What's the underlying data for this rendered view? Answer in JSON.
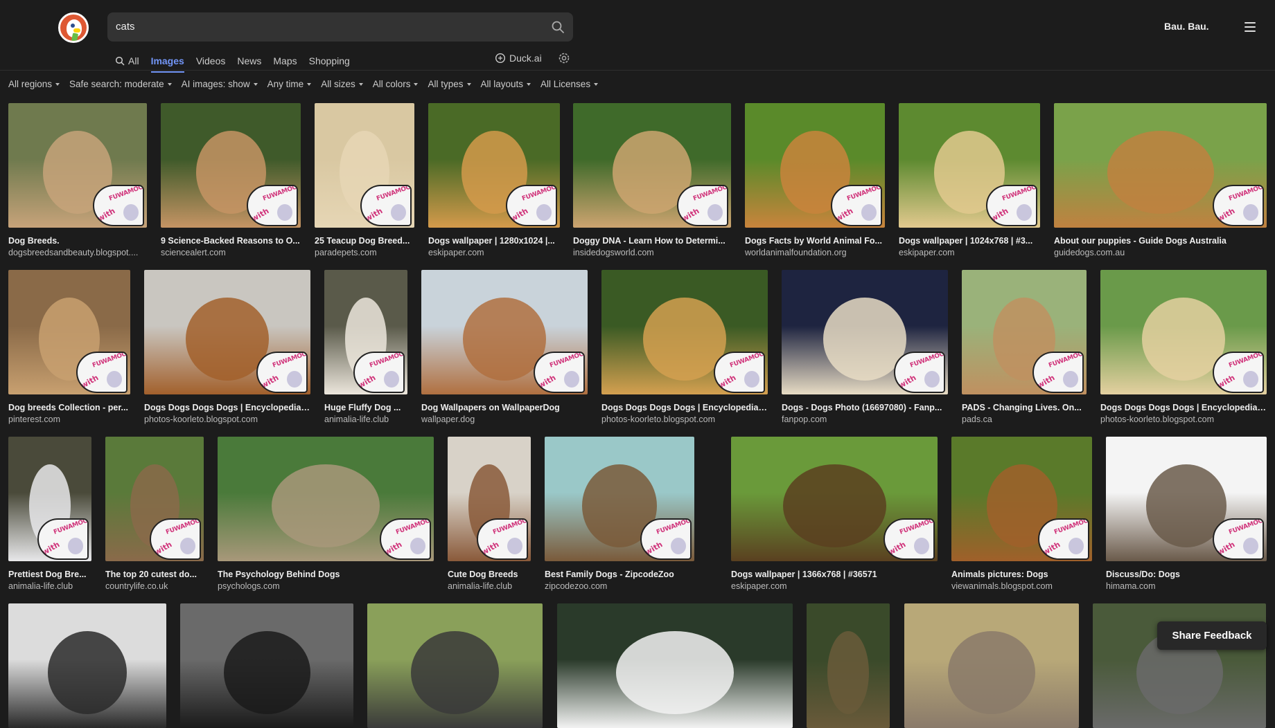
{
  "header": {
    "search_value": "cats",
    "user_label": "Bau. Bau.",
    "duckai_label": "Duck.ai",
    "tabs": [
      {
        "label": "All",
        "icon": "search-icon",
        "active": false
      },
      {
        "label": "Images",
        "active": true
      },
      {
        "label": "Videos",
        "active": false
      },
      {
        "label": "News",
        "active": false
      },
      {
        "label": "Maps",
        "active": false
      },
      {
        "label": "Shopping",
        "active": false
      }
    ]
  },
  "filters": [
    "All regions",
    "Safe search: moderate",
    "AI images: show",
    "Any time",
    "All sizes",
    "All colors",
    "All types",
    "All layouts",
    "All Licenses"
  ],
  "colors": {
    "accent": "#7295f6",
    "background": "#1c1c1c",
    "logo": "#de5833"
  },
  "rows": [
    [
      {
        "title": "Dog Breeds.",
        "domain": "dogsbreedsandbeauty.blogspot....",
        "colors": [
          "#6f7a4e",
          "#c7a37a"
        ]
      },
      {
        "title": "9 Science-Backed Reasons to O...",
        "domain": "sciencealert.com",
        "colors": [
          "#3f5a2a",
          "#c59464"
        ]
      },
      {
        "title": "25 Teacup Dog Breed...",
        "domain": "paradepets.com",
        "colors": [
          "#d9c8a2",
          "#e6d6b5"
        ]
      },
      {
        "title": "Dogs wallpaper | 1280x1024 |...",
        "domain": "eskipaper.com",
        "colors": [
          "#4a6a26",
          "#d49a4b"
        ]
      },
      {
        "title": "Doggy DNA - Learn How to Determi...",
        "domain": "insidedogsworld.com",
        "colors": [
          "#3f6a2a",
          "#cda470"
        ]
      },
      {
        "title": "Dogs Facts by World Animal Fo...",
        "domain": "worldanimalfoundation.org",
        "colors": [
          "#5a8a2a",
          "#c9843c"
        ]
      },
      {
        "title": "Dogs wallpaper | 1024x768 | #3...",
        "domain": "eskipaper.com",
        "colors": [
          "#5d8a30",
          "#e2c98e"
        ]
      },
      {
        "title": "About our puppies - Guide Dogs Australia",
        "domain": "guidedogs.com.au",
        "colors": [
          "#7aa24a",
          "#c08140"
        ]
      }
    ],
    [
      {
        "title": "Dog breeds Collection - per...",
        "domain": "pinterest.com",
        "colors": [
          "#8a6a48",
          "#c8a070"
        ]
      },
      {
        "title": "Dogs Dogs Dogs Dogs | Encyclopedia ...",
        "domain": "photos-koorleto.blogspot.com",
        "colors": [
          "#c9c6c0",
          "#a2602c"
        ]
      },
      {
        "title": "Huge Fluffy Dog ...",
        "domain": "animalia-life.club",
        "colors": [
          "#5a5a4a",
          "#ece6dc"
        ]
      },
      {
        "title": "Dog Wallpapers on WallpaperDog",
        "domain": "wallpaper.dog",
        "colors": [
          "#c9d3da",
          "#b07040"
        ]
      },
      {
        "title": "Dogs Dogs Dogs Dogs | Encyclopedia ...",
        "domain": "photos-koorleto.blogspot.com",
        "colors": [
          "#3a5a24",
          "#d4a050"
        ]
      },
      {
        "title": "Dogs - Dogs Photo (16697080) - Fanp...",
        "domain": "fanpop.com",
        "colors": [
          "#1e2440",
          "#e8dcc4"
        ]
      },
      {
        "title": "PADS - Changing Lives. On...",
        "domain": "pads.ca",
        "colors": [
          "#9ab27a",
          "#c09060"
        ]
      },
      {
        "title": "Dogs Dogs Dogs Dogs | Encyclopedia ...",
        "domain": "photos-koorleto.blogspot.com",
        "colors": [
          "#6a9a4a",
          "#e4d0a0"
        ]
      }
    ],
    [
      {
        "title": "Prettiest Dog Bre...",
        "domain": "animalia-life.club",
        "colors": [
          "#4a4a3a",
          "#e8e8ea"
        ]
      },
      {
        "title": "The top 20 cutest do...",
        "domain": "countrylife.co.uk",
        "colors": [
          "#5a7a3a",
          "#8a6a4a"
        ]
      },
      {
        "title": "The Psychology Behind Dogs",
        "domain": "psychologs.com",
        "colors": [
          "#4a7a3a",
          "#a8987a"
        ]
      },
      {
        "title": "Cute Dog Breeds",
        "domain": "animalia-life.club",
        "colors": [
          "#d8d2c8",
          "#8a5a3a"
        ]
      },
      {
        "title": "Best Family Dogs - ZipcodeZoo",
        "domain": "zipcodezoo.com",
        "colors": [
          "#9ac8c8",
          "#7a5a3a"
        ]
      },
      {
        "title": "Dogs wallpaper | 1366x768 | #36571",
        "domain": "eskipaper.com",
        "colors": [
          "#6a9a3a",
          "#5a4020"
        ]
      },
      {
        "title": "Animals pictures: Dogs",
        "domain": "viewanimals.blogspot.com",
        "colors": [
          "#5a7a2a",
          "#a0602a"
        ]
      },
      {
        "title": "Discuss/Do: Dogs",
        "domain": "himama.com",
        "colors": [
          "#f4f4f4",
          "#6a5a4a"
        ]
      }
    ],
    [
      {
        "title": "",
        "domain": "",
        "colors": [
          "#dcdcdc",
          "#2a2a2a"
        ]
      },
      {
        "title": "",
        "domain": "",
        "colors": [
          "#6a6a6a",
          "#1a1a1a"
        ]
      },
      {
        "title": "",
        "domain": "",
        "colors": [
          "#8aa05a",
          "#3a3a3a"
        ]
      },
      {
        "title": "",
        "domain": "",
        "colors": [
          "#2a3a2a",
          "#f2f2f2"
        ]
      },
      {
        "title": "",
        "domain": "",
        "colors": [
          "#3a4a2a",
          "#6a5a3a"
        ]
      },
      {
        "title": "",
        "domain": "",
        "colors": [
          "#b8a878",
          "#8a7a6a"
        ]
      },
      {
        "title": "",
        "domain": "",
        "colors": [
          "#4a5a3a",
          "#6a6a6a"
        ]
      }
    ]
  ],
  "watermark": {
    "with": "with",
    "brand": "FUWAMOCO"
  },
  "feedback_label": "Share Feedback"
}
